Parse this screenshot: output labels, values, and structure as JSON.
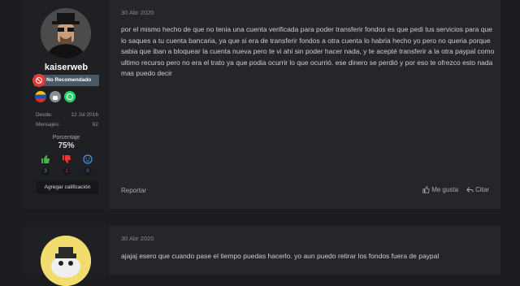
{
  "post1": {
    "username": "kaiserweb",
    "status_badge": "No Recomendado",
    "desde_label": "Desde:",
    "desde_value": "12 Jul 2016",
    "mensajes_label": "Mensajes:",
    "mensajes_value": "82",
    "porcentaje_label": "Porcentaje",
    "porcentaje_value": "75%",
    "reactions": {
      "positive": "3",
      "negative": "1",
      "neutral": "0"
    },
    "rate_button": "Agregar calificación",
    "date": "30 Abr 2020",
    "body": "por el mismo hecho de que no tenia una cuenta verificada para poder transferir fondos es que pedi tus servicios para que lo saques a tu cuenta bancaria, ya que si era de transferir fondos a otra cuenta lo habria hecho yo pero no queria porque sabia que iban a bloquear la cuenta nueva pero te vi ahi sin poder hacer nada, y te acepté transferir a la otra paypal como ultimo recurso pero no era el trato ya que podia ocurrir lo que ocurrió. ese dinero se perdió y por eso te ofrezco esto nada mas puedo decir",
    "report": "Reportar",
    "like": "Me gusta",
    "quote": "Citar"
  },
  "post2": {
    "date": "30 Abr 2020",
    "body": "ajajaj esero que cuando pase el tiempo puedas hacerlo. yo aun puedo retirar los fondos fuera de paypal"
  },
  "colors": {
    "accent": "#e53935",
    "whatsapp": "#25d366",
    "positive": "#4caf50",
    "negative": "#e53935",
    "neutral": "#4a90e2"
  }
}
